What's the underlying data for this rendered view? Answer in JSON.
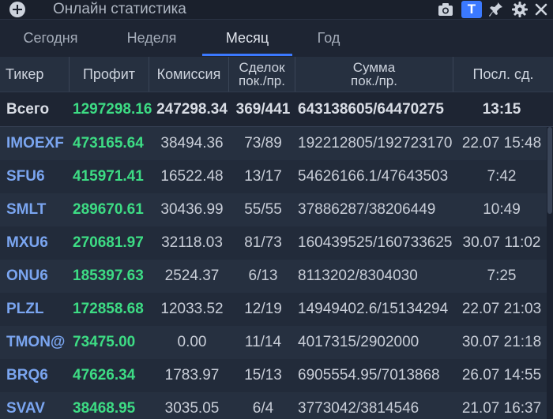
{
  "window": {
    "title": "Онлайн статистика",
    "t_button": "T"
  },
  "tabs": [
    {
      "label": "Сегодня",
      "active": false
    },
    {
      "label": "Неделя",
      "active": false
    },
    {
      "label": "Месяц",
      "active": true
    },
    {
      "label": "Год",
      "active": false
    }
  ],
  "columns": {
    "ticker": "Тикер",
    "profit": "Профит",
    "commission": "Комиссия",
    "deals_1": "Сделок",
    "deals_2": "пок./пр.",
    "sum_1": "Сумма",
    "sum_2": "пок./пр.",
    "last": "Посл. сд."
  },
  "total": {
    "ticker": "Всего",
    "profit": "1297298.16",
    "commission": "247298.34",
    "deals": "369/441",
    "sum": "643138605/64470275",
    "last": "13:15"
  },
  "rows": [
    {
      "ticker": "IMOEXF",
      "profit": "473165.64",
      "commission": "38494.36",
      "deals": "73/89",
      "sum": "192212805/192723170",
      "last": "22.07 15:48"
    },
    {
      "ticker": "SFU6",
      "profit": "415971.41",
      "commission": "16522.48",
      "deals": "13/17",
      "sum": "54626166.1/47643503",
      "last": "7:42"
    },
    {
      "ticker": "SMLT",
      "profit": "289670.61",
      "commission": "30436.99",
      "deals": "55/55",
      "sum": "37886287/38206449",
      "last": "10:49"
    },
    {
      "ticker": "MXU6",
      "profit": "270681.97",
      "commission": "32118.03",
      "deals": "81/73",
      "sum": "160439525/160733625",
      "last": "30.07 11:02"
    },
    {
      "ticker": "ONU6",
      "profit": "185397.63",
      "commission": "2524.37",
      "deals": "6/13",
      "sum": "8113202/8304030",
      "last": "7:25"
    },
    {
      "ticker": "PLZL",
      "profit": "172858.68",
      "commission": "12033.52",
      "deals": "12/19",
      "sum": "14949402.6/15134294",
      "last": "22.07 21:03"
    },
    {
      "ticker": "TMON@",
      "profit": "73475.00",
      "commission": "0.00",
      "deals": "11/14",
      "sum": "4017315/2902000",
      "last": "30.07 21:18"
    },
    {
      "ticker": "BRQ6",
      "profit": "47626.34",
      "commission": "1783.97",
      "deals": "15/13",
      "sum": "6905554.95/7013868",
      "last": "26.07 14:55"
    },
    {
      "ticker": "SVAV",
      "profit": "38468.95",
      "commission": "3035.05",
      "deals": "6/4",
      "sum": "3773042/3814546",
      "last": "21.07 16:37"
    }
  ],
  "icons": {
    "plus": "plus-circle-icon",
    "camera": "camera-icon",
    "pin": "pin-icon",
    "settings": "gear-icon",
    "close": "close-icon"
  },
  "colors": {
    "accent": "#3b79ff",
    "profit_green": "#3ddc84",
    "ticker_blue": "#7aa5f0",
    "background": "#1e2533"
  }
}
